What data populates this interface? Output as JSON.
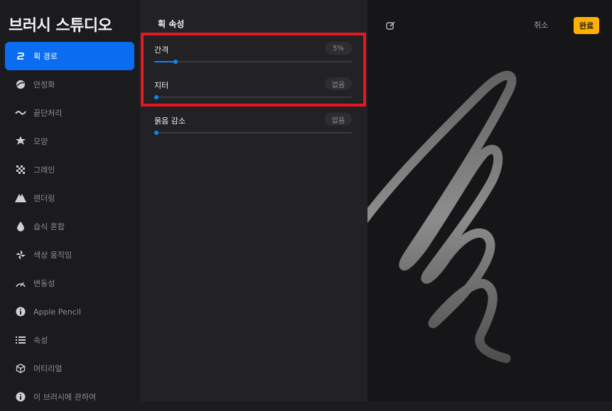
{
  "app": {
    "title": "브러시 스튜디오"
  },
  "sidebar": {
    "items": [
      {
        "label": "획 경로",
        "icon": "stroke-path-icon",
        "active": true
      },
      {
        "label": "안정화",
        "icon": "stabilization-icon"
      },
      {
        "label": "끝단처리",
        "icon": "taper-icon"
      },
      {
        "label": "모양",
        "icon": "shape-icon"
      },
      {
        "label": "그레인",
        "icon": "grain-icon"
      },
      {
        "label": "렌더링",
        "icon": "rendering-icon"
      },
      {
        "label": "습식 혼합",
        "icon": "wet-mix-icon"
      },
      {
        "label": "색상 움직임",
        "icon": "color-dynamics-icon"
      },
      {
        "label": "변동성",
        "icon": "dynamics-icon"
      },
      {
        "label": "Apple Pencil",
        "icon": "apple-pencil-icon"
      },
      {
        "label": "속성",
        "icon": "properties-icon"
      },
      {
        "label": "머티리얼",
        "icon": "materials-icon"
      },
      {
        "label": "이 브러시에 관하여",
        "icon": "about-icon"
      }
    ]
  },
  "panel": {
    "title": "획 속성",
    "settings": [
      {
        "label": "간격",
        "value": "5%",
        "level": 0.05
      },
      {
        "label": "지터",
        "value": "없음",
        "level": 0
      },
      {
        "label": "묽음 감소",
        "value": "없음",
        "level": 0
      }
    ]
  },
  "preview": {
    "cancel_label": "취소",
    "done_label": "완료"
  },
  "colors": {
    "accent": "#0a84ff",
    "active_nav": "#0a6cf0",
    "done_button": "#ffb000",
    "highlight": "#e5171f"
  }
}
